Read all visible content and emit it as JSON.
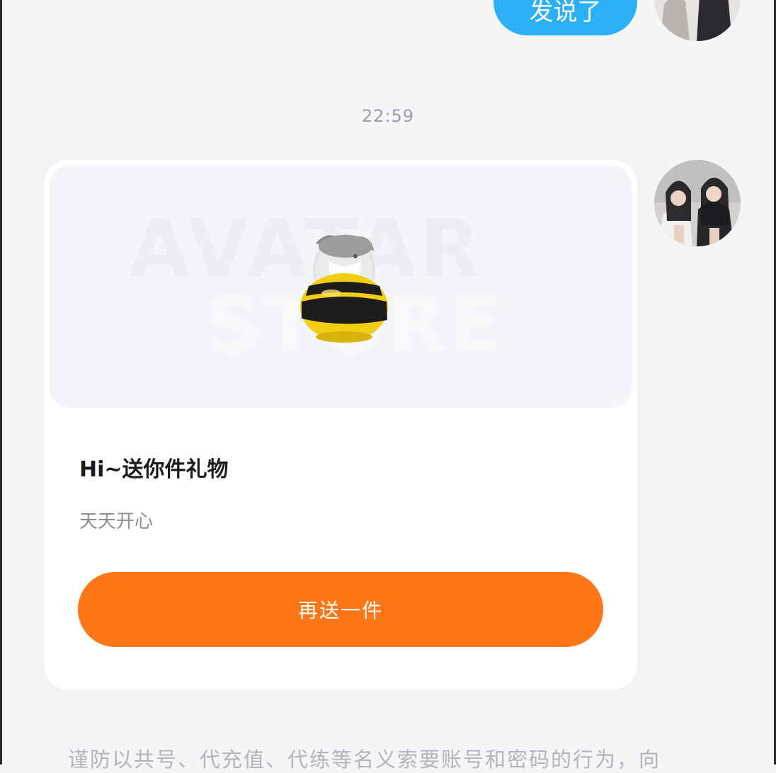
{
  "messages": {
    "top_bubble_text": "发说了",
    "timestamp": "22:59"
  },
  "gift_card": {
    "title": "Hi~送你件礼物",
    "subtitle": "天天开心",
    "button_label": "再送一件",
    "watermark_line1": "AVATAR",
    "watermark_line2": "STORE",
    "gift_icon": "bee-doll-gift-icon"
  },
  "footer": {
    "notice": "谨防以共号、代充值、代练等名义索要账号和密码的行为，向"
  },
  "colors": {
    "sent_bubble": "#2bb0f5",
    "button": "#fe7716",
    "background": "#f4f5f7"
  }
}
